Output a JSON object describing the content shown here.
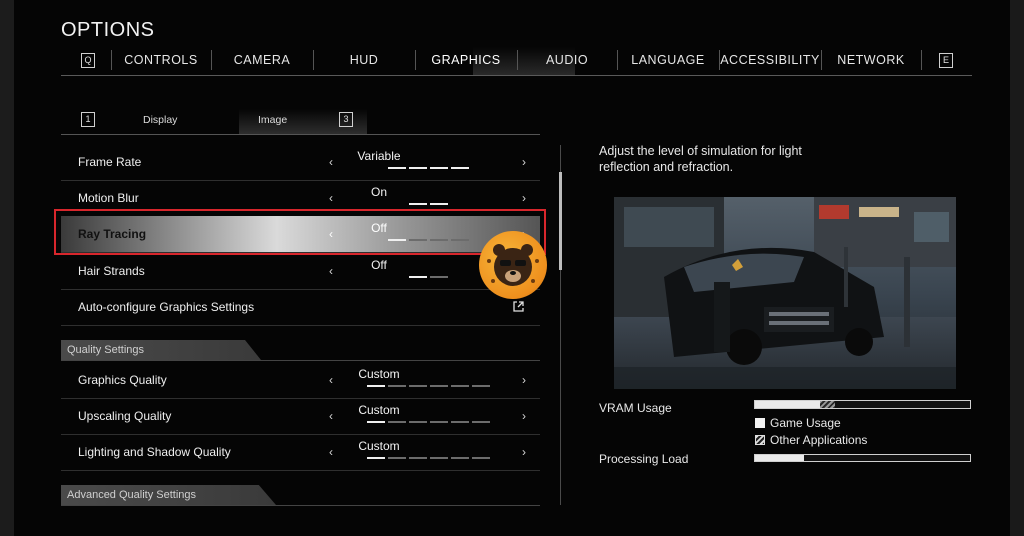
{
  "title": "OPTIONS",
  "tabs": {
    "left_key": "Q",
    "right_key": "E",
    "items": [
      {
        "label": "CONTROLS"
      },
      {
        "label": "CAMERA"
      },
      {
        "label": "HUD"
      },
      {
        "label": "GRAPHICS",
        "active": true
      },
      {
        "label": "AUDIO"
      },
      {
        "label": "LANGUAGE"
      },
      {
        "label": "ACCESSIBILITY"
      },
      {
        "label": "NETWORK"
      }
    ]
  },
  "subtabs": {
    "left_key": "1",
    "right_key": "3",
    "items": [
      {
        "label": "Display"
      },
      {
        "label": "Image",
        "active": true
      }
    ]
  },
  "settings": [
    {
      "label": "Frame Rate",
      "value": "Variable",
      "level": 4,
      "steps": 4
    },
    {
      "label": "Motion Blur",
      "value": "On",
      "level": 2,
      "steps": 2
    },
    {
      "label": "Ray Tracing",
      "value": "Off",
      "level": 1,
      "steps": 4,
      "selected": true
    },
    {
      "label": "Hair Strands",
      "value": "Off",
      "level": 1,
      "steps": 2
    },
    {
      "label": "Auto-configure Graphics Settings"
    }
  ],
  "quality_section": {
    "title": "Quality Settings",
    "items": [
      {
        "label": "Graphics Quality",
        "value": "Custom",
        "level": 1,
        "steps": 6
      },
      {
        "label": "Upscaling Quality",
        "value": "Custom",
        "level": 1,
        "steps": 6
      },
      {
        "label": "Lighting and Shadow Quality",
        "value": "Custom",
        "level": 1,
        "steps": 6
      }
    ]
  },
  "advanced_section": {
    "title": "Advanced Quality Settings"
  },
  "arrows": {
    "left": "‹",
    "right": "›"
  },
  "description": "Adjust the level of simulation for light reflection and refraction.",
  "vram": {
    "label": "VRAM Usage",
    "game_usage_fraction": 0.3,
    "other_apps_fraction": 0.07,
    "legend_game": "Game Usage",
    "legend_other": "Other Applications"
  },
  "processing": {
    "label": "Processing Load",
    "fraction": 0.23
  },
  "colors": {
    "selection_outline": "#d8262c",
    "badge": "#ee8f1d"
  }
}
